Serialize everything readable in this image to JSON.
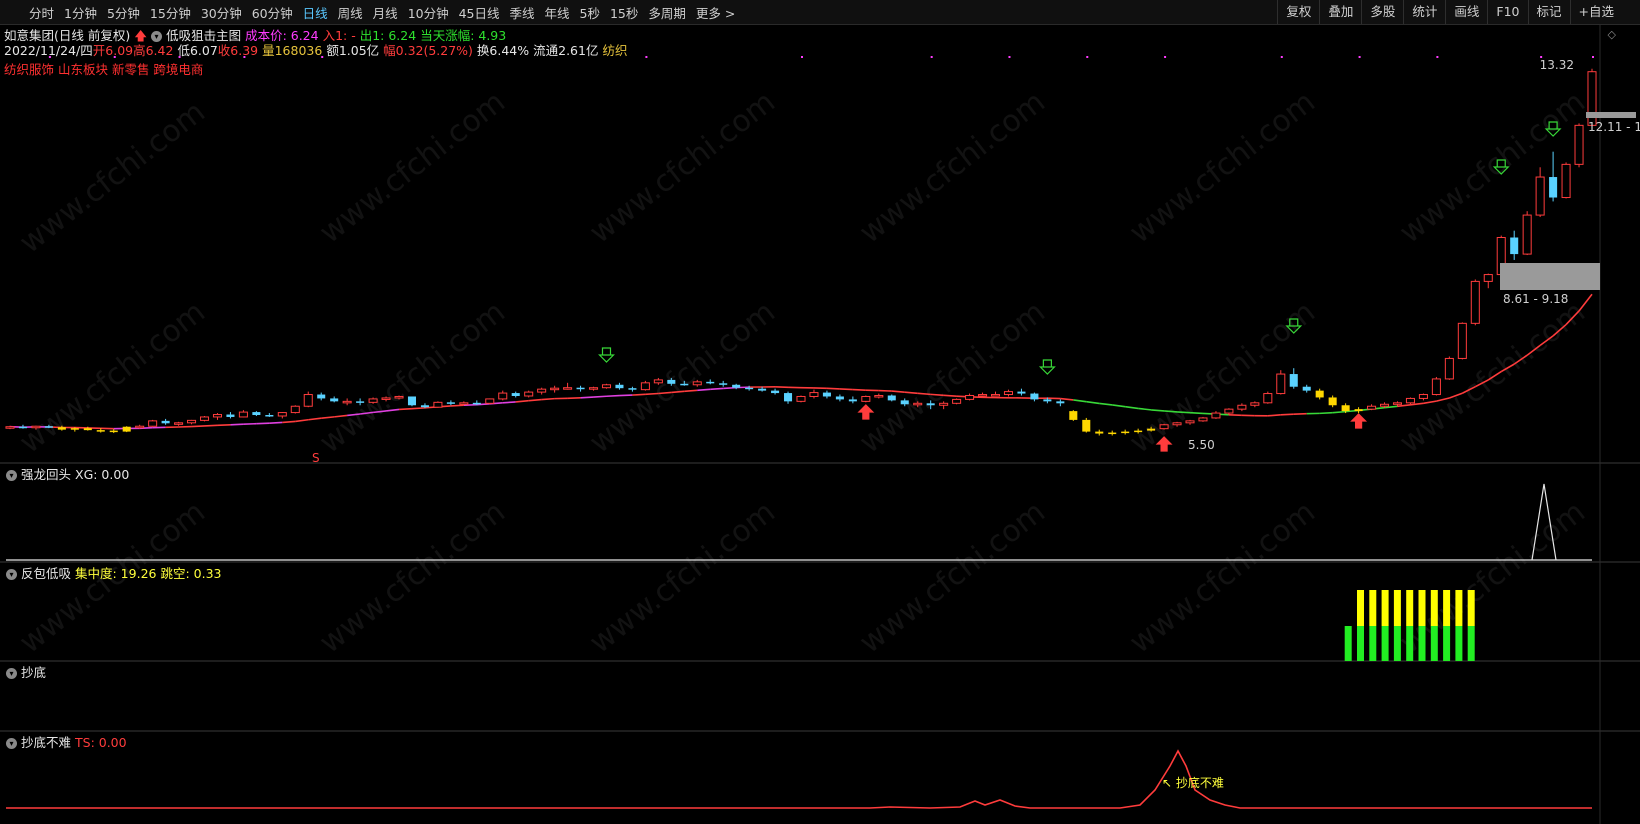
{
  "toolbar": {
    "timeframes": [
      "分时",
      "1分钟",
      "5分钟",
      "15分钟",
      "30分钟",
      "60分钟",
      "日线",
      "周线",
      "月线",
      "10分钟",
      "45日线",
      "季线",
      "年线",
      "5秒",
      "15秒",
      "多周期",
      "更多 >"
    ],
    "active": "日线",
    "tools": [
      "复权",
      "叠加",
      "多股",
      "统计",
      "画线",
      "F10",
      "标记",
      "+自选"
    ]
  },
  "header": {
    "stock": "如意集团(日线 前复权)",
    "indicator": "低吸狙击主图",
    "cost_label": "成本价: 6.24",
    "in_label": "入1: -",
    "out_label": "出1: 6.24",
    "change_label": "当天涨幅: 4.93",
    "date": "2022/11/24/四",
    "open": "开6.09",
    "high": "高6.42",
    "low": "低6.07",
    "close": "收6.39",
    "volume": "量168036",
    "amount": "额1.05亿",
    "range": "幅0.32(5.27%)",
    "turnover": "换6.44%",
    "float": "流通2.61亿",
    "sector": "纺织",
    "blocks": "纺织服饰 山东板块 新零售 跨境电商"
  },
  "main_chart": {
    "labels": {
      "high": "13.32",
      "low": "5.50",
      "zone_upper": "12.11 - 1",
      "zone_lower": "8.61 - 9.18",
      "s_mark": "S"
    }
  },
  "panels": {
    "p1": {
      "name": "强龙回头",
      "value": "XG: 0.00"
    },
    "p2": {
      "name": "反包低吸",
      "v1": "集中度: 19.26",
      "v2": "跳空: 0.33"
    },
    "p3": {
      "name": "抄底"
    },
    "p4": {
      "name": "抄底不难",
      "value": "TS: 0.00",
      "annotation": "↖ 抄底不难"
    }
  },
  "watermark": "www.cfchi.com",
  "colors": {
    "up": "#ff3c3c",
    "down": "#5ad2ff",
    "yellow": "#ffd700",
    "magenta": "#e040e0",
    "green": "#38d838",
    "bg": "#000000"
  },
  "chart_data": {
    "type": "candlestick",
    "title": "如意集团(日线 前复权)",
    "date_last": "2022/11/24",
    "candles": [
      [
        5.96,
        6.0,
        5.93,
        5.98
      ],
      [
        5.98,
        6.02,
        5.94,
        5.96
      ],
      [
        5.96,
        6.0,
        5.92,
        5.99
      ],
      [
        5.99,
        6.02,
        5.95,
        5.97
      ],
      [
        5.97,
        6.0,
        5.9,
        5.92
      ],
      [
        5.92,
        5.97,
        5.88,
        5.95
      ],
      [
        5.95,
        5.98,
        5.9,
        5.91
      ],
      [
        5.91,
        5.95,
        5.86,
        5.9
      ],
      [
        5.9,
        5.93,
        5.85,
        5.88
      ],
      [
        5.88,
        5.99,
        5.87,
        5.98
      ],
      [
        5.98,
        6.02,
        5.94,
        5.99
      ],
      [
        5.99,
        6.12,
        5.98,
        6.1
      ],
      [
        6.1,
        6.14,
        6.02,
        6.05
      ],
      [
        6.05,
        6.08,
        6.0,
        6.06
      ],
      [
        6.06,
        6.12,
        6.03,
        6.11
      ],
      [
        6.11,
        6.2,
        6.09,
        6.18
      ],
      [
        6.18,
        6.26,
        6.12,
        6.23
      ],
      [
        6.23,
        6.28,
        6.15,
        6.18
      ],
      [
        6.18,
        6.32,
        6.17,
        6.28
      ],
      [
        6.28,
        6.3,
        6.2,
        6.22
      ],
      [
        6.22,
        6.26,
        6.18,
        6.2
      ],
      [
        6.2,
        6.28,
        6.15,
        6.27
      ],
      [
        6.27,
        6.42,
        6.25,
        6.4
      ],
      [
        6.4,
        6.7,
        6.38,
        6.64
      ],
      [
        6.64,
        6.68,
        6.52,
        6.56
      ],
      [
        6.56,
        6.6,
        6.48,
        6.5
      ],
      [
        6.5,
        6.56,
        6.42,
        6.5
      ],
      [
        6.5,
        6.56,
        6.42,
        6.48
      ],
      [
        6.48,
        6.58,
        6.45,
        6.55
      ],
      [
        6.55,
        6.6,
        6.5,
        6.57
      ],
      [
        6.57,
        6.62,
        6.54,
        6.6
      ],
      [
        6.6,
        6.6,
        6.4,
        6.42
      ],
      [
        6.42,
        6.46,
        6.36,
        6.38
      ],
      [
        6.38,
        6.5,
        6.37,
        6.48
      ],
      [
        6.48,
        6.52,
        6.42,
        6.47
      ],
      [
        6.47,
        6.5,
        6.42,
        6.47
      ],
      [
        6.47,
        6.52,
        6.42,
        6.46
      ],
      [
        6.46,
        6.56,
        6.44,
        6.55
      ],
      [
        6.55,
        6.72,
        6.52,
        6.67
      ],
      [
        6.67,
        6.7,
        6.58,
        6.61
      ],
      [
        6.61,
        6.72,
        6.58,
        6.69
      ],
      [
        6.69,
        6.78,
        6.64,
        6.75
      ],
      [
        6.75,
        6.82,
        6.68,
        6.77
      ],
      [
        6.77,
        6.88,
        6.74,
        6.78
      ],
      [
        6.78,
        6.82,
        6.7,
        6.77
      ],
      [
        6.77,
        6.8,
        6.72,
        6.78
      ],
      [
        6.78,
        6.86,
        6.76,
        6.84
      ],
      [
        6.84,
        6.88,
        6.74,
        6.77
      ],
      [
        6.77,
        6.8,
        6.7,
        6.74
      ],
      [
        6.74,
        6.92,
        6.72,
        6.88
      ],
      [
        6.88,
        6.98,
        6.84,
        6.94
      ],
      [
        6.94,
        6.98,
        6.82,
        6.86
      ],
      [
        6.86,
        6.92,
        6.82,
        6.84
      ],
      [
        6.84,
        6.94,
        6.8,
        6.9
      ],
      [
        6.9,
        6.95,
        6.85,
        6.87
      ],
      [
        6.87,
        6.92,
        6.8,
        6.84
      ],
      [
        6.84,
        6.86,
        6.75,
        6.78
      ],
      [
        6.78,
        6.82,
        6.72,
        6.76
      ],
      [
        6.76,
        6.8,
        6.7,
        6.72
      ],
      [
        6.72,
        6.76,
        6.64,
        6.67
      ],
      [
        6.67,
        6.7,
        6.45,
        6.5
      ],
      [
        6.5,
        6.62,
        6.48,
        6.6
      ],
      [
        6.6,
        6.74,
        6.56,
        6.68
      ],
      [
        6.68,
        6.72,
        6.56,
        6.6
      ],
      [
        6.6,
        6.64,
        6.5,
        6.54
      ],
      [
        6.54,
        6.6,
        6.46,
        6.5
      ],
      [
        6.5,
        6.62,
        6.48,
        6.6
      ],
      [
        6.6,
        6.66,
        6.56,
        6.62
      ],
      [
        6.62,
        6.64,
        6.5,
        6.52
      ],
      [
        6.52,
        6.56,
        6.4,
        6.44
      ],
      [
        6.44,
        6.5,
        6.38,
        6.46
      ],
      [
        6.46,
        6.52,
        6.34,
        6.42
      ],
      [
        6.42,
        6.5,
        6.34,
        6.46
      ],
      [
        6.46,
        6.56,
        6.44,
        6.54
      ],
      [
        6.54,
        6.66,
        6.52,
        6.62
      ],
      [
        6.62,
        6.68,
        6.58,
        6.64
      ],
      [
        6.64,
        6.7,
        6.6,
        6.64
      ],
      [
        6.64,
        6.74,
        6.6,
        6.7
      ],
      [
        6.7,
        6.76,
        6.62,
        6.66
      ],
      [
        6.66,
        6.68,
        6.5,
        6.54
      ],
      [
        6.54,
        6.58,
        6.46,
        6.5
      ],
      [
        6.5,
        6.54,
        6.4,
        6.46
      ],
      [
        6.3,
        6.32,
        6.1,
        6.12
      ],
      [
        6.12,
        6.16,
        5.86,
        5.88
      ],
      [
        5.88,
        5.92,
        5.8,
        5.84
      ],
      [
        5.84,
        5.9,
        5.8,
        5.86
      ],
      [
        5.86,
        5.92,
        5.82,
        5.88
      ],
      [
        5.88,
        5.94,
        5.84,
        5.9
      ],
      [
        5.9,
        5.98,
        5.88,
        5.94
      ],
      [
        5.94,
        6.04,
        5.92,
        6.02
      ],
      [
        6.02,
        6.08,
        5.98,
        6.06
      ],
      [
        6.06,
        6.12,
        6.02,
        6.1
      ],
      [
        6.1,
        6.18,
        6.08,
        6.16
      ],
      [
        6.16,
        6.3,
        6.14,
        6.26
      ],
      [
        6.26,
        6.36,
        6.22,
        6.34
      ],
      [
        6.34,
        6.46,
        6.3,
        6.42
      ],
      [
        6.42,
        6.5,
        6.38,
        6.47
      ],
      [
        6.47,
        6.7,
        6.45,
        6.66
      ],
      [
        6.66,
        7.14,
        6.64,
        7.06
      ],
      [
        7.06,
        7.18,
        6.76,
        6.8
      ],
      [
        6.8,
        6.84,
        6.68,
        6.72
      ],
      [
        6.72,
        6.76,
        6.54,
        6.58
      ],
      [
        6.58,
        6.62,
        6.38,
        6.42
      ],
      [
        6.42,
        6.46,
        6.26,
        6.3
      ],
      [
        6.3,
        6.38,
        6.26,
        6.34
      ],
      [
        6.34,
        6.44,
        6.32,
        6.4
      ],
      [
        6.4,
        6.48,
        6.36,
        6.44
      ],
      [
        6.44,
        6.5,
        6.4,
        6.47
      ],
      [
        6.47,
        6.58,
        6.44,
        6.56
      ],
      [
        6.56,
        6.66,
        6.52,
        6.64
      ],
      [
        6.64,
        7.0,
        6.62,
        6.96
      ],
      [
        6.96,
        7.42,
        6.94,
        7.38
      ],
      [
        7.38,
        8.12,
        7.36,
        8.1
      ],
      [
        8.1,
        9.0,
        8.06,
        8.96
      ],
      [
        8.96,
        9.12,
        8.82,
        9.1
      ],
      [
        9.1,
        9.9,
        9.06,
        9.86
      ],
      [
        9.86,
        10.0,
        9.4,
        9.52
      ],
      [
        9.52,
        10.4,
        9.5,
        10.32
      ],
      [
        10.32,
        11.3,
        10.28,
        11.1
      ],
      [
        11.1,
        11.62,
        10.6,
        10.68
      ],
      [
        10.68,
        11.4,
        10.66,
        11.36
      ],
      [
        11.36,
        12.2,
        11.3,
        12.16
      ],
      [
        12.16,
        13.32,
        12.14,
        13.26
      ]
    ],
    "low_label": 5.5,
    "high_label": 13.32
  }
}
